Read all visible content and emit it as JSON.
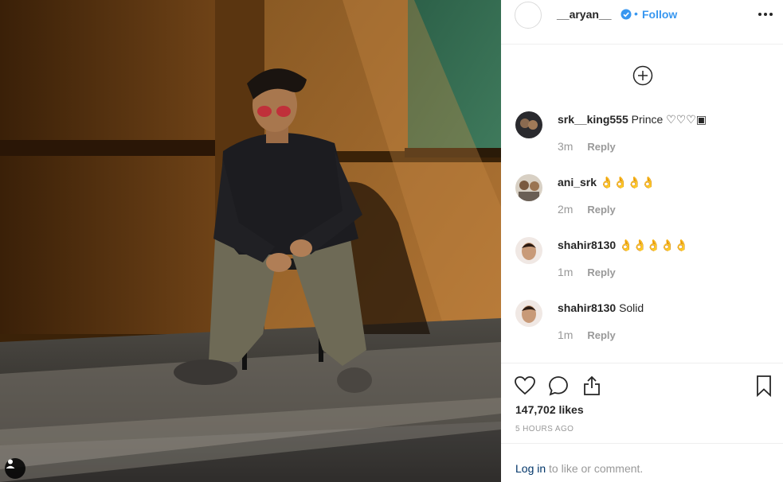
{
  "post": {
    "username": "__aryan__",
    "separator": "•",
    "follow_label": "Follow",
    "likes": "147,702 likes",
    "timestamp": "5 HOURS AGO"
  },
  "comments": [
    {
      "user": "srk__king555",
      "text": "Prince ♡♡♡▣",
      "age": "3m",
      "reply": "Reply"
    },
    {
      "user": "ani_srk",
      "text": "👌👌👌👌",
      "age": "2m",
      "reply": "Reply"
    },
    {
      "user": "shahir8130",
      "text": "👌👌👌👌👌",
      "age": "1m",
      "reply": "Reply"
    },
    {
      "user": "shahir8130",
      "text": "Solid",
      "age": "1m",
      "reply": "Reply"
    }
  ],
  "footer": {
    "login_link": "Log in",
    "login_suffix": " to like or comment."
  },
  "icons": {
    "header": [
      "verified-badge-icon",
      "more-options-icon"
    ],
    "load_more": "plus-circle-icon",
    "actions": [
      "heart-icon",
      "comment-icon",
      "share-icon",
      "bookmark-icon"
    ],
    "photo": "user-tag-icon"
  },
  "colors": {
    "accent": "#3897f0",
    "link_dark": "#003569",
    "muted": "#999999",
    "text": "#262626"
  }
}
